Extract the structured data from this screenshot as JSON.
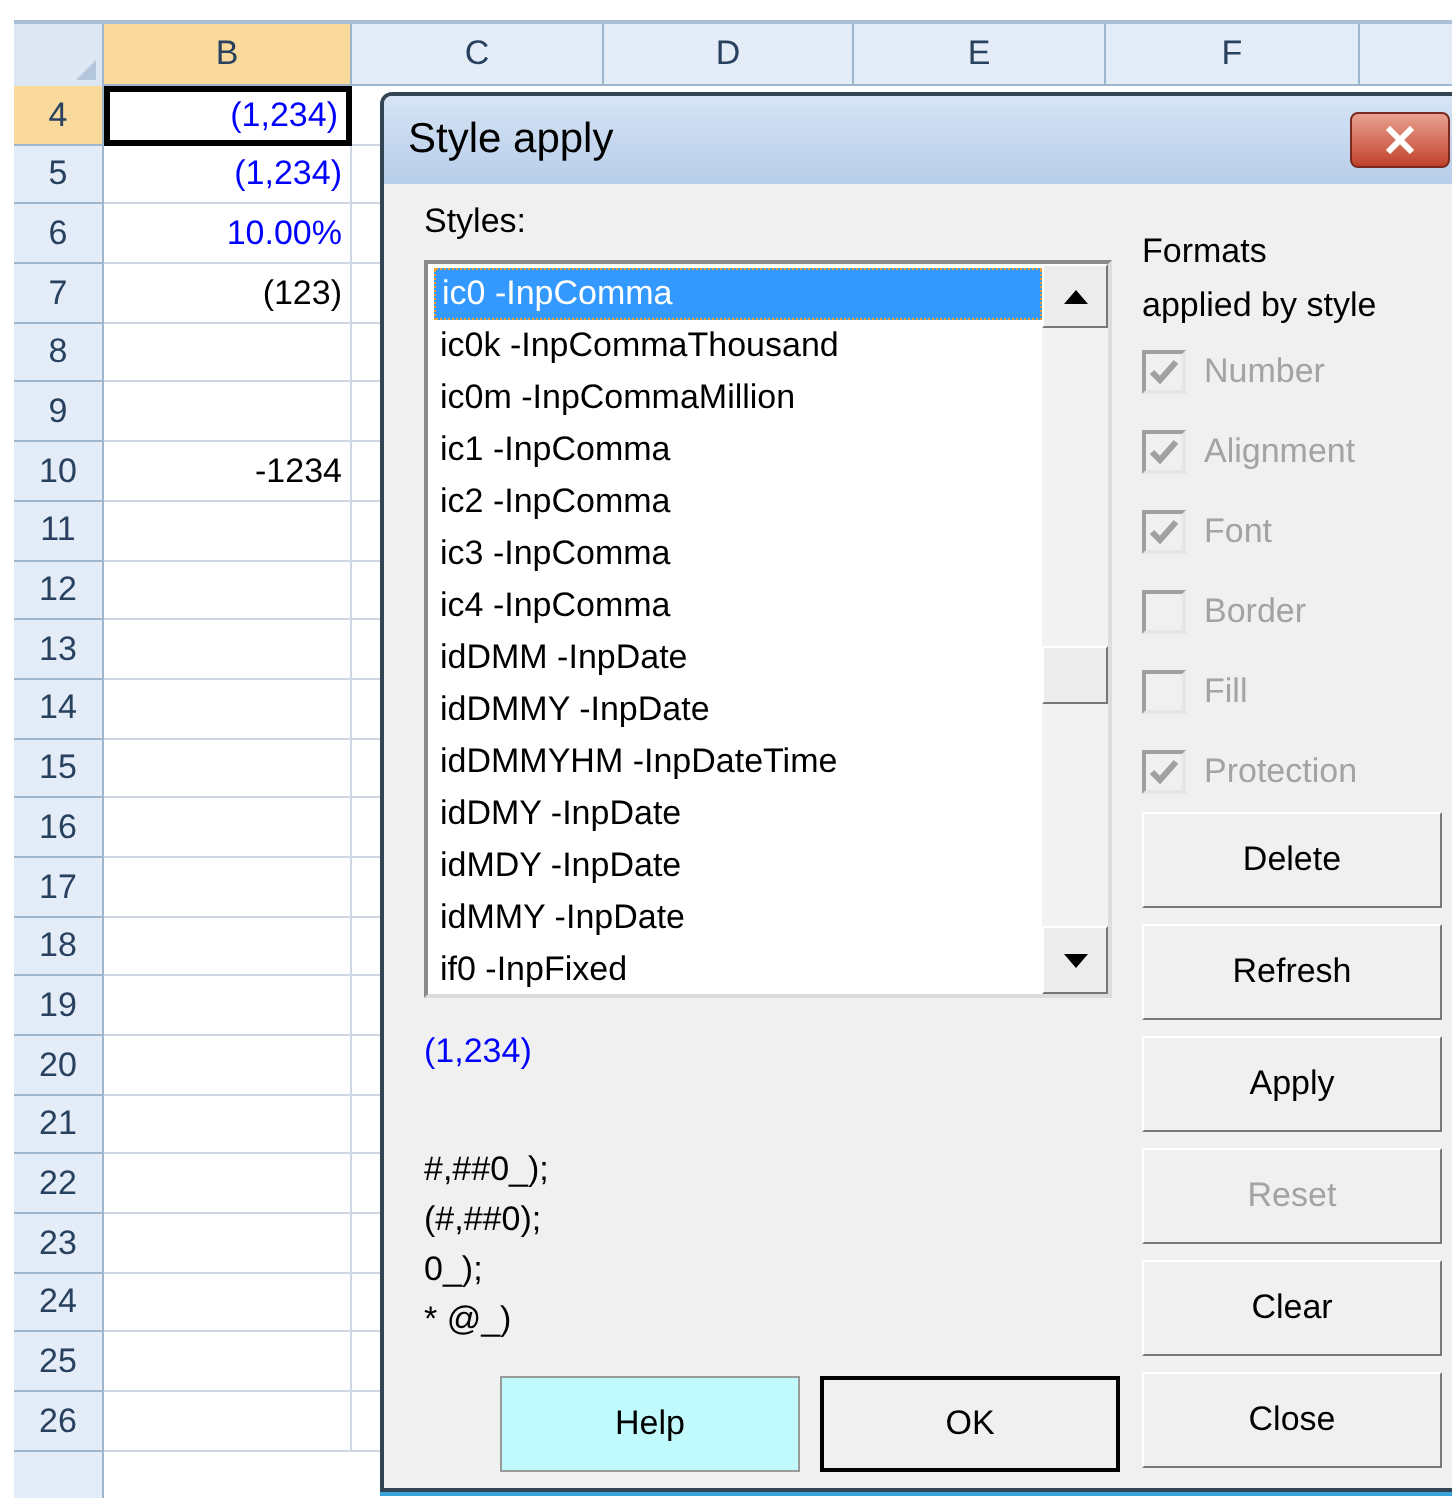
{
  "sheet": {
    "columns": [
      {
        "label": "B",
        "selected": true
      },
      {
        "label": "C",
        "selected": false
      },
      {
        "label": "D",
        "selected": false
      },
      {
        "label": "E",
        "selected": false
      },
      {
        "label": "F",
        "selected": false
      }
    ],
    "rows": [
      {
        "number": "4",
        "selected": true,
        "value": "(1,234)",
        "color": "#0000ff"
      },
      {
        "number": "5",
        "selected": false,
        "value": "(1,234)",
        "color": "#0000ff"
      },
      {
        "number": "6",
        "selected": false,
        "value": "10.00%",
        "color": "#0000ff"
      },
      {
        "number": "7",
        "selected": false,
        "value": "(123)",
        "color": "#000000"
      },
      {
        "number": "8",
        "selected": false
      },
      {
        "number": "9",
        "selected": false
      },
      {
        "number": "10",
        "selected": false,
        "value": "-1234",
        "color": "#000000"
      },
      {
        "number": "11",
        "selected": false
      },
      {
        "number": "12",
        "selected": false
      },
      {
        "number": "13",
        "selected": false
      },
      {
        "number": "14",
        "selected": false
      },
      {
        "number": "15",
        "selected": false
      },
      {
        "number": "16",
        "selected": false
      },
      {
        "number": "17",
        "selected": false
      },
      {
        "number": "18",
        "selected": false
      },
      {
        "number": "19",
        "selected": false
      },
      {
        "number": "20",
        "selected": false
      },
      {
        "number": "21",
        "selected": false
      },
      {
        "number": "22",
        "selected": false
      },
      {
        "number": "23",
        "selected": false
      },
      {
        "number": "24",
        "selected": false
      },
      {
        "number": "25",
        "selected": false
      },
      {
        "number": "26",
        "selected": false
      }
    ]
  },
  "dialog": {
    "title": "Style apply",
    "styles_label": {
      "text": "Styles:"
    },
    "styles": [
      {
        "name": "ic0 -InpComma",
        "selected": true
      },
      {
        "name": "ic0k -InpCommaThousand",
        "selected": false
      },
      {
        "name": "ic0m -InpCommaMillion",
        "selected": false
      },
      {
        "name": "ic1 -InpComma",
        "selected": false
      },
      {
        "name": "ic2 -InpComma",
        "selected": false
      },
      {
        "name": "ic3 -InpComma",
        "selected": false
      },
      {
        "name": "ic4 -InpComma",
        "selected": false
      },
      {
        "name": "idDMM -InpDate",
        "selected": false
      },
      {
        "name": "idDMMY -InpDate",
        "selected": false
      },
      {
        "name": "idDMMYHM -InpDateTime",
        "selected": false
      },
      {
        "name": "idDMY -InpDate",
        "selected": false
      },
      {
        "name": "idMDY -InpDate",
        "selected": false
      },
      {
        "name": "idMMY -InpDate",
        "selected": false
      },
      {
        "name": "if0 -InpFixed",
        "selected": false
      }
    ],
    "preview": "(1,234)",
    "format_lines": [
      "#,##0_);",
      "(#,##0);",
      "0_);",
      "* @_)"
    ],
    "formats_label": [
      "Formats",
      "applied by style"
    ],
    "formats": [
      {
        "label": "Number",
        "checked": true,
        "disabled": true
      },
      {
        "label": "Alignment",
        "checked": true,
        "disabled": true
      },
      {
        "label": "Font",
        "checked": true,
        "disabled": true
      },
      {
        "label": "Border",
        "checked": false,
        "disabled": true
      },
      {
        "label": "Fill",
        "checked": false,
        "disabled": true
      },
      {
        "label": "Protection",
        "checked": true,
        "disabled": true
      }
    ],
    "side_buttons": [
      {
        "label": "Delete",
        "disabled": false
      },
      {
        "label": "Refresh",
        "disabled": false
      },
      {
        "label": "Apply",
        "disabled": false
      },
      {
        "label": "Reset",
        "disabled": true
      },
      {
        "label": "Clear",
        "disabled": false
      },
      {
        "label": "Close",
        "disabled": false
      }
    ],
    "bottom_buttons": [
      {
        "label": "Help",
        "kind": "help"
      },
      {
        "label": "OK",
        "kind": "default"
      }
    ]
  }
}
